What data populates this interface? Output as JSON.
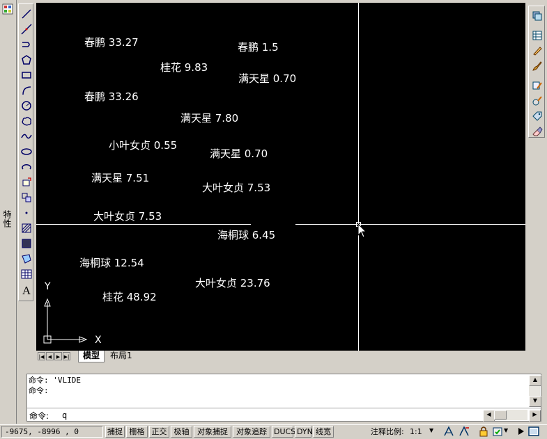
{
  "canvas": {
    "plant_labels": [
      "春鹏 33.27",
      "春鹏 1.5",
      "桂花 9.83",
      "满天星 0.70",
      "春鹏 33.26",
      "满天星 7.80",
      "小叶女贞 0.55",
      "满天星 0.70",
      "满天星 7.51",
      "大叶女贞 7.53",
      "大叶女贞 7.53",
      "海桐球 6.45",
      "海桐球 12.54",
      "大叶女贞 23.76",
      "桂花 48.92"
    ],
    "ucs": {
      "y_label": "Y",
      "x_label": "X"
    }
  },
  "side_panel": {
    "label": "特性"
  },
  "layout_tabs": {
    "model": "模型",
    "layout1": "布局1"
  },
  "command": {
    "history": [
      "命令: 'VLIDE",
      "命令:"
    ],
    "prompt": "命令:",
    "input_value": "q"
  },
  "status": {
    "coords": "-9675, -8996 , 0",
    "toggles": [
      "捕捉",
      "栅格",
      "正交",
      "极轴",
      "对象捕捉",
      "对象追踪",
      "DUCS",
      "DYN",
      "线宽"
    ],
    "annotation_scale_label": "注释比例:",
    "annotation_scale_value": "1:1"
  },
  "icons": {
    "draw_tools": [
      "line-icon",
      "construction-line-icon",
      "polyline-icon",
      "polygon-icon",
      "rectangle-icon",
      "arc-icon",
      "circle-icon",
      "revision-cloud-icon",
      "spline-icon",
      "ellipse-icon",
      "ellipse-arc-icon",
      "insert-block-icon",
      "make-block-icon",
      "point-icon",
      "hatch-icon",
      "gradient-icon",
      "region-icon",
      "table-icon",
      "multiline-text-icon"
    ],
    "modify_tools": [
      "layer-icon",
      "layer-properties-icon",
      "pencil-icon",
      "brush-icon",
      "match-properties-icon",
      "block-editor-icon",
      "tag-icon",
      "erase-tool-icon"
    ]
  },
  "colors": {
    "canvas": "#000000",
    "text": "#ffffff",
    "chrome": "#d4d0c8"
  }
}
